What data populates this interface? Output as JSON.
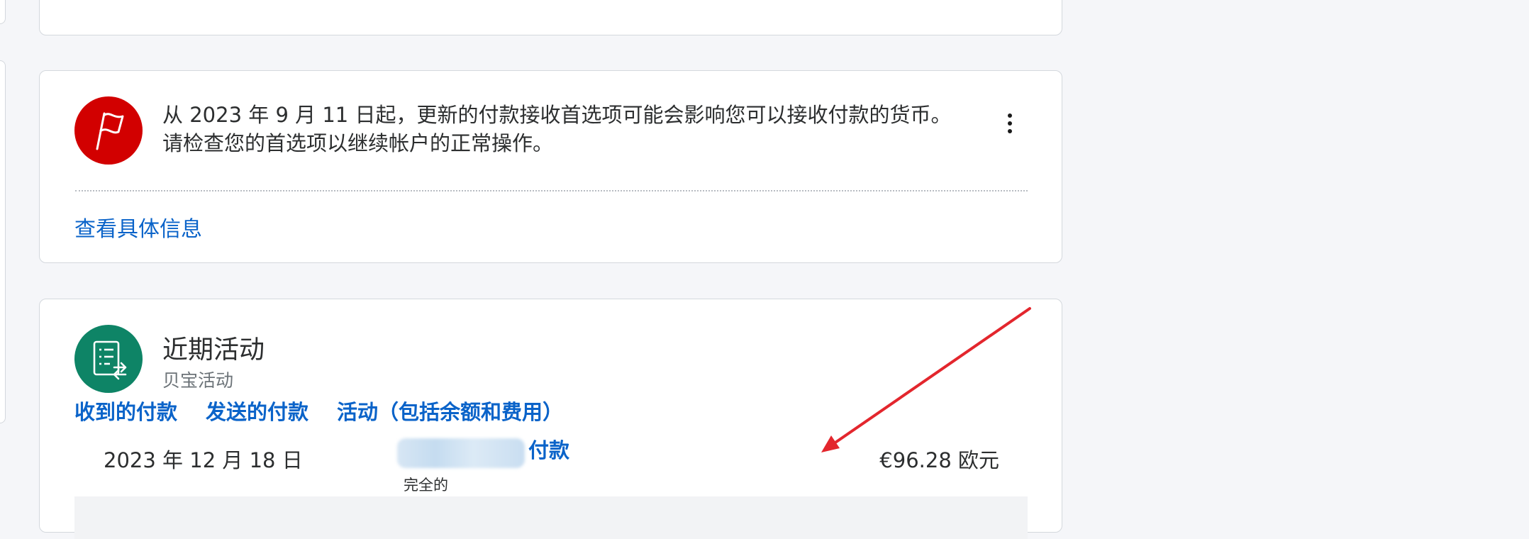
{
  "notice": {
    "text_line1": "从 2023 年 9 月 11 日起，更新的付款接收首选项可能会影响您可以接收付款的货币。",
    "text_line2": "请检查您的首选项以继续帐户的正常操作。",
    "details_link": "查看具体信息",
    "icon": "flag-icon",
    "icon_color": "#d20000"
  },
  "activity": {
    "title": "近期活动",
    "subtitle": "贝宝活动",
    "icon": "transactions-icon",
    "icon_color": "#0e8466",
    "tabs": [
      {
        "label": "收到的付款"
      },
      {
        "label": "发送的付款"
      },
      {
        "label": "活动（包括余额和费用）"
      }
    ],
    "rows": [
      {
        "date": "2023 年 12 月 18 日",
        "name": "付款",
        "status": "完全的",
        "amount": "€96.28 欧元"
      }
    ]
  },
  "colors": {
    "link": "#0a63c9",
    "annotation_arrow": "#e3262d"
  }
}
